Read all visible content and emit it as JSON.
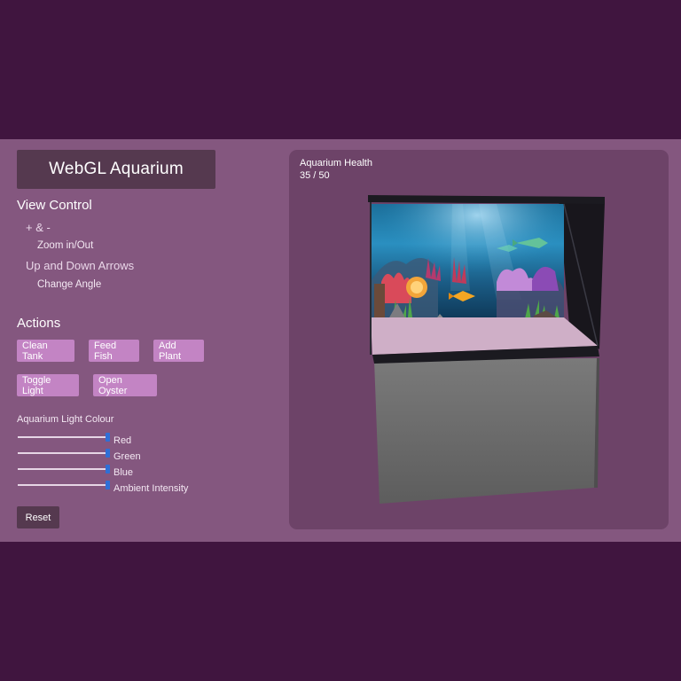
{
  "app": {
    "title": "WebGL Aquarium"
  },
  "view_control": {
    "heading": "View Control",
    "zoom_keys": "+ & -",
    "zoom_desc": "Zoom in/Out",
    "angle_keys": "Up and Down Arrows",
    "angle_desc": "Change Angle"
  },
  "actions": {
    "heading": "Actions",
    "buttons": [
      "Clean Tank",
      "Feed Fish",
      "Add Plant",
      "Toggle Light",
      "Open Oyster"
    ]
  },
  "light": {
    "heading": "Aquarium Light Colour",
    "sliders": [
      {
        "label": "Red",
        "value": 1.0
      },
      {
        "label": "Green",
        "value": 1.0
      },
      {
        "label": "Blue",
        "value": 1.0
      },
      {
        "label": "Ambient Intensity",
        "value": 1.0
      }
    ],
    "reset_label": "Reset"
  },
  "health": {
    "label": "Aquarium Health",
    "value": "35 / 50"
  },
  "colors": {
    "background": "#40153f",
    "band": "#84577f",
    "panel": "#6d4368",
    "button": "#c384c4",
    "dark_button": "#55394f",
    "slider_thumb": "#2f6fd6"
  }
}
